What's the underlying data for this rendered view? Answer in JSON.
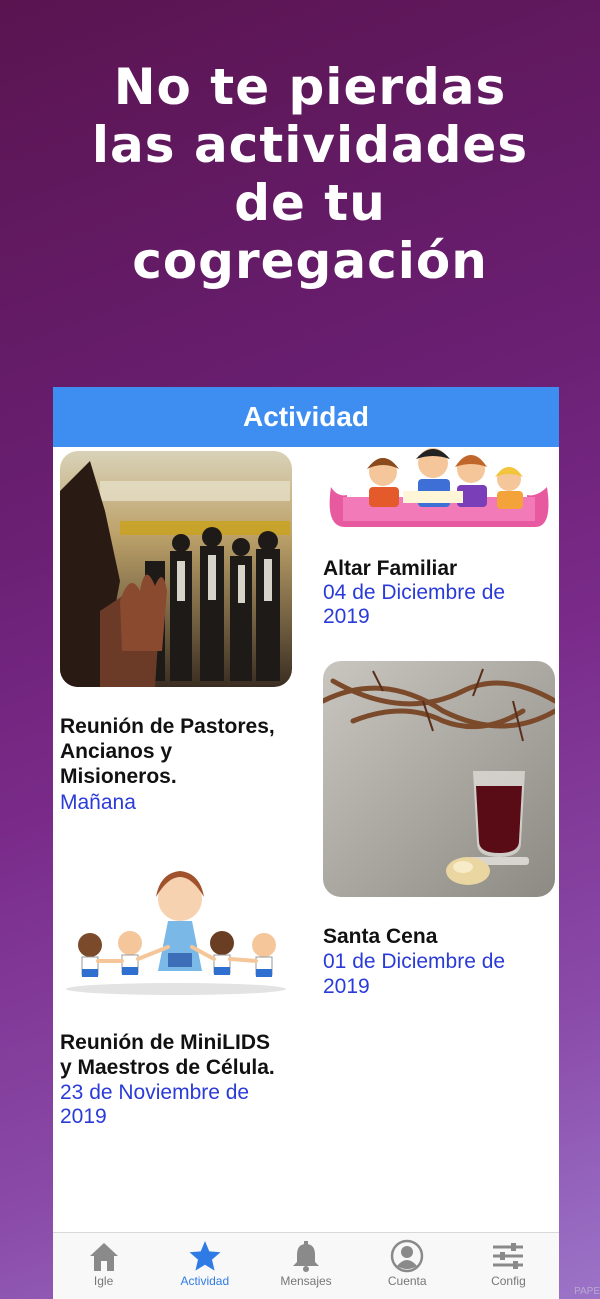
{
  "promo": {
    "line1": "No te pierdas",
    "line2": "las actividades",
    "line3": "de tu",
    "line4": "cogregación"
  },
  "header": {
    "title": "Actividad"
  },
  "activities": [
    {
      "title": "Reunión de Pastores,\n Ancianos y\nMisioneros.",
      "date": "Mañana"
    },
    {
      "title": "Altar Familiar",
      "date_line1": "04 de Diciembre de",
      "date_line2": "2019"
    },
    {
      "title": "Reunión de MiniLIDS\ny Maestros de Célula.",
      "date_line1": "23 de Noviembre de",
      "date_line2": "2019"
    },
    {
      "title": "Santa Cena",
      "date_line1": "01 de Diciembre de",
      "date_line2": "2019"
    }
  ],
  "tabs": [
    {
      "label": "Igle",
      "icon": "church-icon",
      "active": false
    },
    {
      "label": "Actividad",
      "icon": "star-icon",
      "active": true
    },
    {
      "label": "Mensajes",
      "icon": "bell-icon",
      "active": false
    },
    {
      "label": "Cuenta",
      "icon": "user-icon",
      "active": false
    },
    {
      "label": "Config",
      "icon": "sliders-icon",
      "active": false
    }
  ],
  "watermark": "PAPE",
  "colors": {
    "accent": "#3d8ef0",
    "date_text": "#2a3bd8",
    "active_tab": "#2f7be6"
  }
}
